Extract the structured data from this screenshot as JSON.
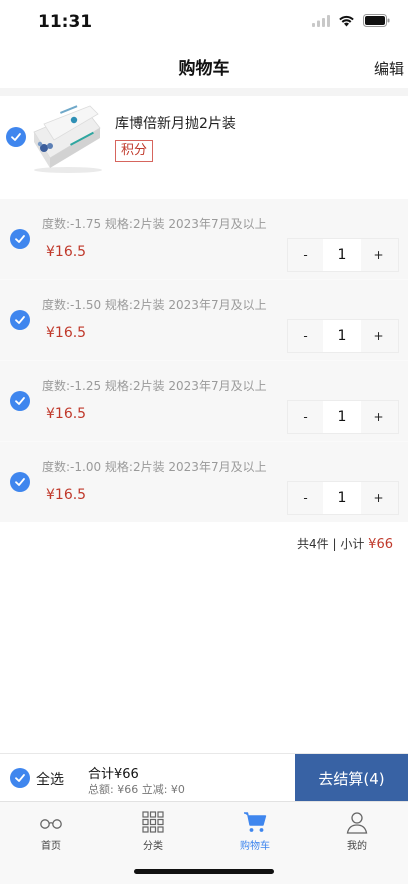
{
  "status_bar": {
    "time": "11:31"
  },
  "nav": {
    "title": "购物车",
    "edit_label": "编辑"
  },
  "product": {
    "name": "库博倍新月抛2片装",
    "badge": "积分"
  },
  "skus": [
    {
      "spec": "度数:-1.75 规格:2片装   2023年7月及以上",
      "price": "¥16.5",
      "minus": "-",
      "qty": "1",
      "plus": "+"
    },
    {
      "spec": "度数:-1.50 规格:2片装   2023年7月及以上",
      "price": "¥16.5",
      "minus": "-",
      "qty": "1",
      "plus": "+"
    },
    {
      "spec": "度数:-1.25 规格:2片装   2023年7月及以上",
      "price": "¥16.5",
      "minus": "-",
      "qty": "1",
      "plus": "+"
    },
    {
      "spec": "度数:-1.00 规格:2片装   2023年7月及以上",
      "price": "¥16.5",
      "minus": "-",
      "qty": "1",
      "plus": "+"
    }
  ],
  "subtotal": {
    "label": "共4件 | 小计",
    "amount": "¥66"
  },
  "checkout": {
    "select_all": "全选",
    "total": "合计¥66",
    "detail": "总额: ¥66 立减: ¥0",
    "button": "去结算(4)"
  },
  "tabs": [
    {
      "label": "首页",
      "icon": "glasses-icon",
      "active": false
    },
    {
      "label": "分类",
      "icon": "grid-icon",
      "active": false
    },
    {
      "label": "购物车",
      "icon": "cart-icon",
      "active": true
    },
    {
      "label": "我的",
      "icon": "user-icon",
      "active": false
    }
  ],
  "colors": {
    "accent": "#3f86ee",
    "checkout_button": "#3862a4",
    "price": "#c0392b"
  }
}
